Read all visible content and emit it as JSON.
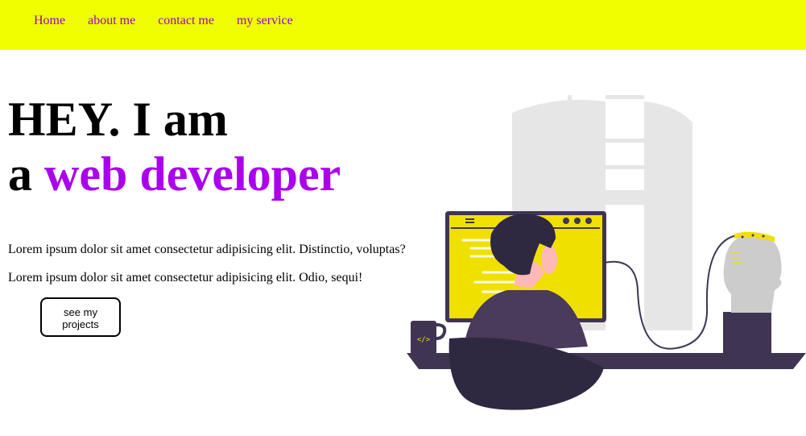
{
  "nav": {
    "items": [
      {
        "label": "Home"
      },
      {
        "label": "about me"
      },
      {
        "label": "contact me"
      },
      {
        "label": "my service"
      }
    ]
  },
  "hero": {
    "line1": "HEY. I am",
    "line2_prefix": "a",
    "line2_accent": "web developer",
    "paragraphs": [
      "Lorem ipsum dolor sit amet consectetur adipisicing elit. Distinctio, voluptas?",
      "Lorem ipsum dolor sit amet consectetur adipisicing elit. Odio, sequi!"
    ],
    "cta_label": "see my projects"
  },
  "colors": {
    "navbar_bg": "#f0ff00",
    "nav_link": "#9900cc",
    "accent": "#aa00ee",
    "monitor_screen": "#f0e000",
    "dark_purple": "#3f3553"
  }
}
